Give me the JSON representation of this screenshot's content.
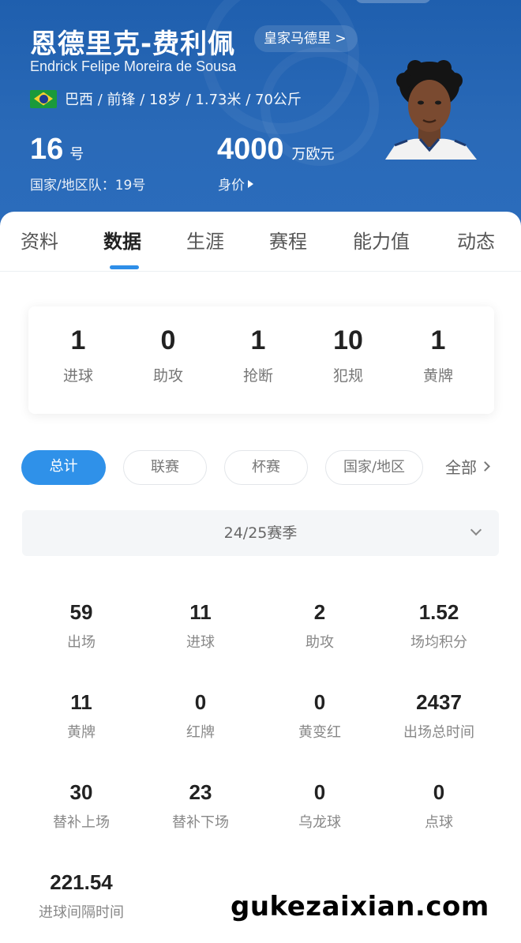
{
  "player": {
    "name_cn": "恩德里克-费利佩",
    "club_link": "皇家马德里 >",
    "name_en": "Endrick Felipe Moreira de Sousa",
    "info": "巴西 / 前锋 / 18岁 / 1.73米 / 70公斤",
    "shirt_number": "16",
    "shirt_unit": "号",
    "national_team": "国家/地区队：19号",
    "market_value": "4000",
    "market_value_unit": "万欧元",
    "market_value_label": "身价"
  },
  "tabs": [
    "资料",
    "数据",
    "生涯",
    "赛程",
    "能力值",
    "动态"
  ],
  "summary": [
    {
      "value": "1",
      "label": "进球"
    },
    {
      "value": "0",
      "label": "助攻"
    },
    {
      "value": "1",
      "label": "抢断"
    },
    {
      "value": "10",
      "label": "犯规"
    },
    {
      "value": "1",
      "label": "黄牌"
    }
  ],
  "filters": {
    "items": [
      "总计",
      "联赛",
      "杯赛",
      "国家/地区"
    ],
    "all": "全部"
  },
  "season": "24/25赛季",
  "stats": [
    {
      "value": "59",
      "label": "出场"
    },
    {
      "value": "11",
      "label": "进球"
    },
    {
      "value": "2",
      "label": "助攻"
    },
    {
      "value": "1.52",
      "label": "场均积分"
    },
    {
      "value": "11",
      "label": "黄牌"
    },
    {
      "value": "0",
      "label": "红牌"
    },
    {
      "value": "0",
      "label": "黄变红"
    },
    {
      "value": "2437",
      "label": "出场总时间"
    },
    {
      "value": "30",
      "label": "替补上场"
    },
    {
      "value": "23",
      "label": "替补下场"
    },
    {
      "value": "0",
      "label": "乌龙球"
    },
    {
      "value": "0",
      "label": "点球"
    },
    {
      "value": "221.54",
      "label": "进球间隔时间"
    }
  ],
  "watermark": "gukezaixian.com",
  "colors": {
    "hero": "#2a6ab8",
    "accent": "#2f91e9"
  }
}
